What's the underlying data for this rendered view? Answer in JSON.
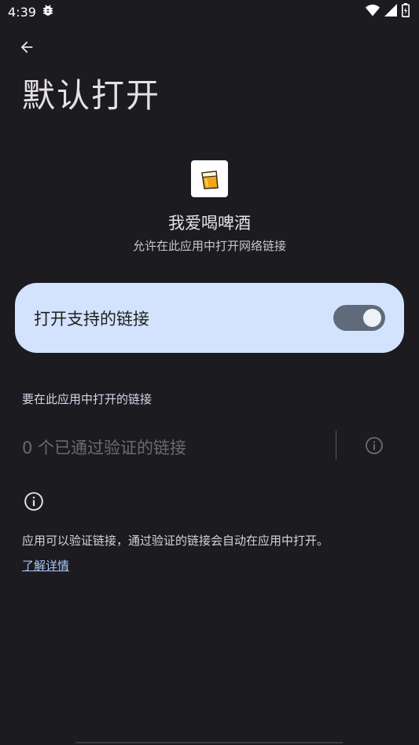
{
  "status_bar": {
    "time": "4:39",
    "notification_icon": "bug-icon",
    "icons": [
      "wifi-icon",
      "cellular-signal-icon",
      "battery-charging-icon"
    ]
  },
  "header": {
    "back_icon": "arrow-back-icon",
    "title": "默认打开"
  },
  "app": {
    "icon": "beer-app-icon",
    "name": "我爱喝啤酒",
    "subtitle": "允许在此应用中打开网络链接"
  },
  "toggle": {
    "label": "打开支持的链接",
    "state": "on",
    "card_color": "#d3e3fd"
  },
  "links_section": {
    "header": "要在此应用中打开的链接",
    "verified_links": "0 个已通过验证的链接",
    "info_icon": "info-icon"
  },
  "footer": {
    "info_icon": "info-icon",
    "description": "应用可以验证链接，通过验证的链接会自动在应用中打开。",
    "learn_more": "了解详情"
  },
  "colors": {
    "background": "#1c1b1f",
    "accent_link": "#a8c7fa",
    "switch_track": "#5f6b7a"
  }
}
